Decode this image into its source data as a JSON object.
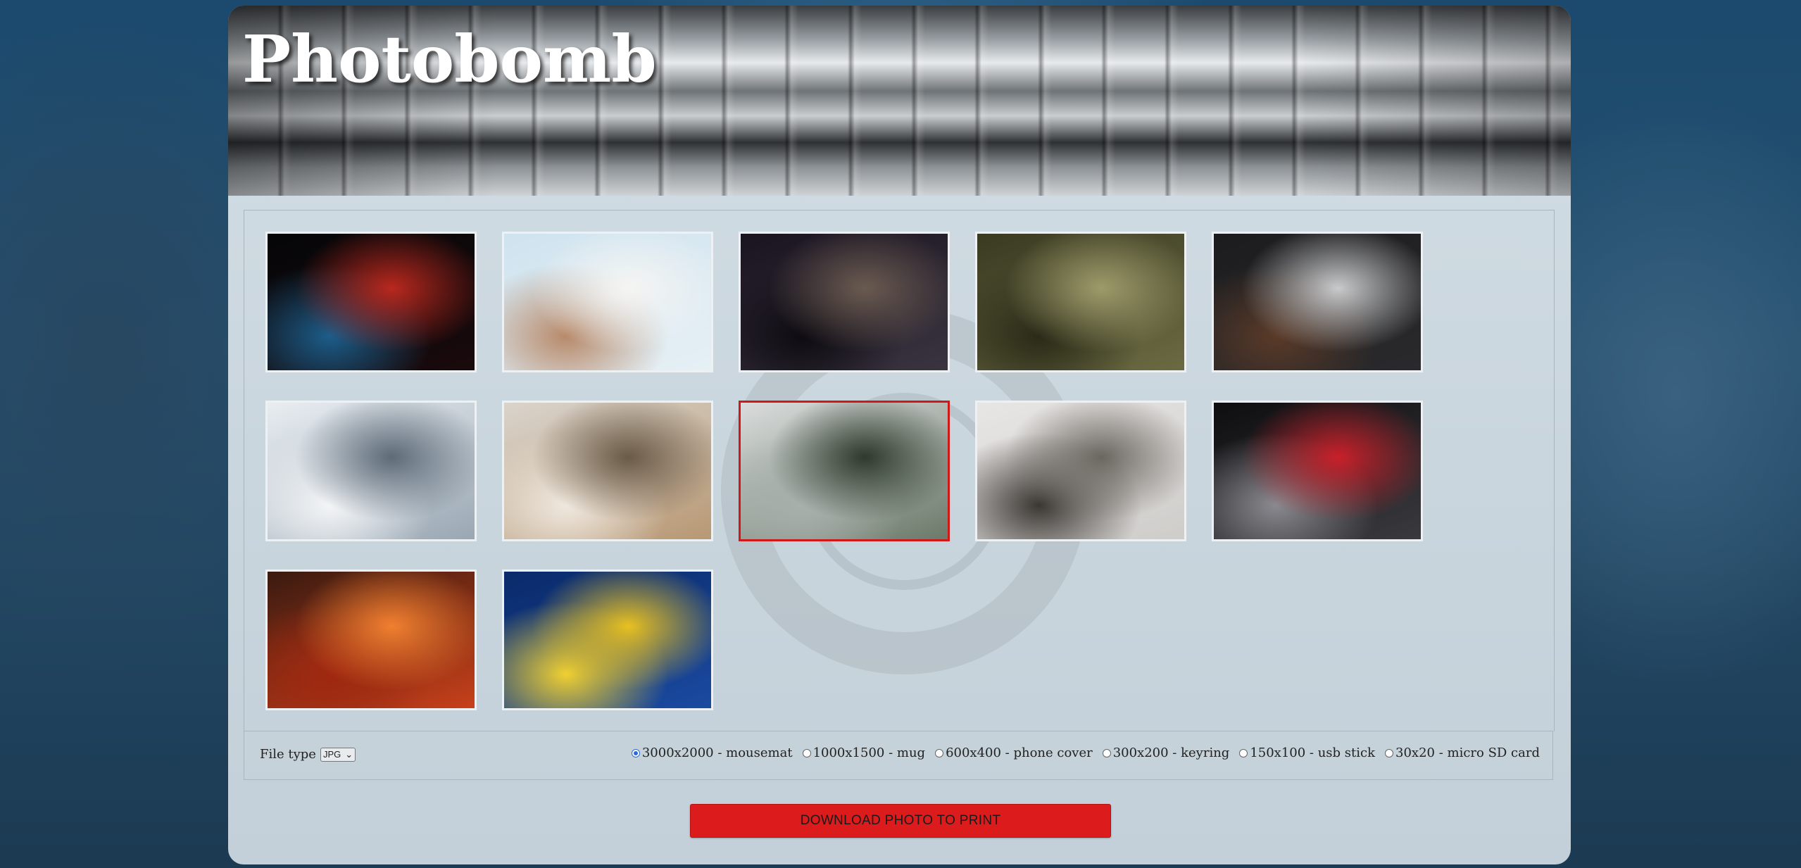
{
  "header": {
    "title": "Photobomb"
  },
  "gallery": {
    "photos": [
      {
        "name": "dark-red-blue-lights",
        "selected": false,
        "colors": [
          "#050608",
          "#1a0a0c",
          "#b8281e",
          "#1c5d8a"
        ]
      },
      {
        "name": "white-blossoms-sky",
        "selected": false,
        "colors": [
          "#cfe3ef",
          "#e6f0f5",
          "#f5f5f3",
          "#b88a6a"
        ]
      },
      {
        "name": "skyscrapers-night",
        "selected": false,
        "colors": [
          "#1a1420",
          "#3a3440",
          "#6a5a50",
          "#0e0c12"
        ]
      },
      {
        "name": "succulent-plants",
        "selected": false,
        "colors": [
          "#3a3a22",
          "#6b6a42",
          "#9d9a6a",
          "#2a2a18"
        ]
      },
      {
        "name": "imac-desk",
        "selected": false,
        "colors": [
          "#1c1c1e",
          "#2a2a2c",
          "#c9cacb",
          "#5a3a28"
        ]
      },
      {
        "name": "frozen-waterfall",
        "selected": false,
        "colors": [
          "#e8edf1",
          "#9aa7b3",
          "#5e6b78",
          "#f3f5f7"
        ]
      },
      {
        "name": "woodworking-tools",
        "selected": false,
        "colors": [
          "#d9d4cc",
          "#b89874",
          "#6a5a48",
          "#efe8de"
        ]
      },
      {
        "name": "greenhouse-interior",
        "selected": true,
        "colors": [
          "#d9dcdc",
          "#6c7a6a",
          "#2e3a2c",
          "#a8b0ac"
        ]
      },
      {
        "name": "misty-coastline",
        "selected": false,
        "colors": [
          "#e8e6e4",
          "#cfcdca",
          "#6a6660",
          "#3a3632"
        ]
      },
      {
        "name": "red-car-detail",
        "selected": false,
        "colors": [
          "#0e0e10",
          "#3a3a3e",
          "#c8202a",
          "#8a8a90"
        ]
      },
      {
        "name": "boat-sunset",
        "selected": false,
        "colors": [
          "#3a1a10",
          "#c8401a",
          "#f08030",
          "#a02810"
        ]
      },
      {
        "name": "yellow-tree-blue-sky",
        "selected": false,
        "colors": [
          "#0a2a6a",
          "#1a4aa0",
          "#e8c020",
          "#f0d030"
        ]
      }
    ]
  },
  "controls": {
    "file_type_label": "File type",
    "file_type_value": "JPG",
    "sizes": [
      {
        "label": "3000x2000 - mousemat",
        "selected": true
      },
      {
        "label": "1000x1500 - mug",
        "selected": false
      },
      {
        "label": "600x400 - phone cover",
        "selected": false
      },
      {
        "label": "300x200 - keyring",
        "selected": false
      },
      {
        "label": "150x100 - usb stick",
        "selected": false
      },
      {
        "label": "30x20 - micro SD card",
        "selected": false
      }
    ]
  },
  "download_button": {
    "label": "DOWNLOAD PHOTO TO PRINT"
  },
  "colors": {
    "accent": "#dc1c1c",
    "selected_border": "#d01818",
    "radio_selected": "#2a6ad8"
  }
}
